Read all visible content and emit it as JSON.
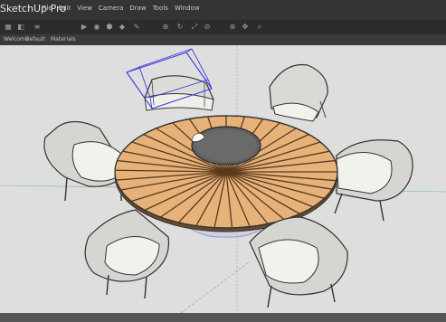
{
  "app": {
    "title": "SketchUp Pro"
  },
  "menu": [
    "File",
    "Edit",
    "View",
    "Camera",
    "Draw",
    "Tools",
    "Window"
  ],
  "toolbar": {
    "buttons": [
      {
        "icon": "grid-icon",
        "glyph": "▦"
      },
      {
        "icon": "cube-icon",
        "glyph": "◧"
      },
      {
        "icon": "list-icon",
        "glyph": "≡"
      },
      {
        "icon": "play-icon",
        "glyph": "▶"
      },
      {
        "icon": "select-icon",
        "glyph": "◉"
      },
      {
        "icon": "paint-icon",
        "glyph": "⬢"
      },
      {
        "icon": "eraser-icon",
        "glyph": "◆"
      },
      {
        "icon": "pencil-icon",
        "glyph": "✎"
      },
      {
        "icon": "move-icon",
        "glyph": "⊕"
      },
      {
        "icon": "rotate-icon",
        "glyph": "↻"
      },
      {
        "icon": "scale-icon",
        "glyph": "⤢"
      },
      {
        "icon": "tape-icon",
        "glyph": "⊘"
      },
      {
        "icon": "orbit-icon",
        "glyph": "⊗"
      },
      {
        "icon": "pan-icon",
        "glyph": "✥"
      },
      {
        "icon": "zoom-icon",
        "glyph": "⌕"
      }
    ]
  },
  "tabs": [
    "Welcome",
    "Default",
    "Materials"
  ],
  "status": {
    "text": ""
  },
  "colors": {
    "accent": "#3a3ae0",
    "wood_light": "#e6b27a",
    "wood_dark": "#c58a4e",
    "chair_seat": "#f2f2ec"
  }
}
